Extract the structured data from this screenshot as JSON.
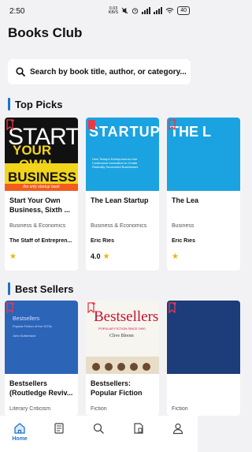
{
  "status_bar": {
    "time": "2:50",
    "speed_value": "0.03",
    "speed_unit": "KB/S",
    "battery": "40"
  },
  "header": {
    "title": "Books Club"
  },
  "search": {
    "placeholder": "Search by book title, author, or category..."
  },
  "sections": {
    "top_picks": {
      "title": "Top Picks",
      "books": [
        {
          "title": "Start Your Own Business, Sixth ...",
          "category": "Business & Economics",
          "author": "The Staff of Entrepren...",
          "rating": "",
          "cover_text": "START",
          "cover_text2": "YOUR",
          "cover_text3": "OWN",
          "cover_text4": "BUSINESS",
          "cover_strip": "the only startup book"
        },
        {
          "title": "The Lean Startup",
          "category": "Business & Economics",
          "author": "Eric Ries",
          "rating": "4.0",
          "cover_text": "STARTUP",
          "cover_sub": "How Today's Entrepreneurs Use Continuous Innovation to Create Radically Successful Businesses"
        },
        {
          "title": "The Lea",
          "category": "Business",
          "author": "Eric Ries",
          "rating": "",
          "cover_text": "THE L"
        }
      ]
    },
    "best_sellers": {
      "title": "Best Sellers",
      "books": [
        {
          "title": "Bestsellers (Routledge Reviv...",
          "category": "Literary Criticism",
          "cover_text": "Bestsellers",
          "cover_sub": "Popular Fiction of the 1970s",
          "cover_author": "John Sutherland"
        },
        {
          "title": "Bestsellers: Popular Fiction S...",
          "category": "Fiction",
          "cover_text": "Bestsellers",
          "cover_sub": "POPULAR FICTION SINCE 1900",
          "cover_author": "Clive Bloom"
        },
        {
          "title": "",
          "category": "Fiction"
        }
      ]
    }
  },
  "bottom_nav": [
    {
      "label": "Home",
      "icon": "home-icon",
      "active": true
    },
    {
      "label": "",
      "icon": "books-icon"
    },
    {
      "label": "",
      "icon": "search-icon"
    },
    {
      "label": "",
      "icon": "bookmark-doc-icon"
    },
    {
      "label": "",
      "icon": "profile-icon"
    }
  ],
  "colors": {
    "accent": "#1e73c8",
    "bookmark": "#e8394a",
    "star": "#e8b600"
  }
}
